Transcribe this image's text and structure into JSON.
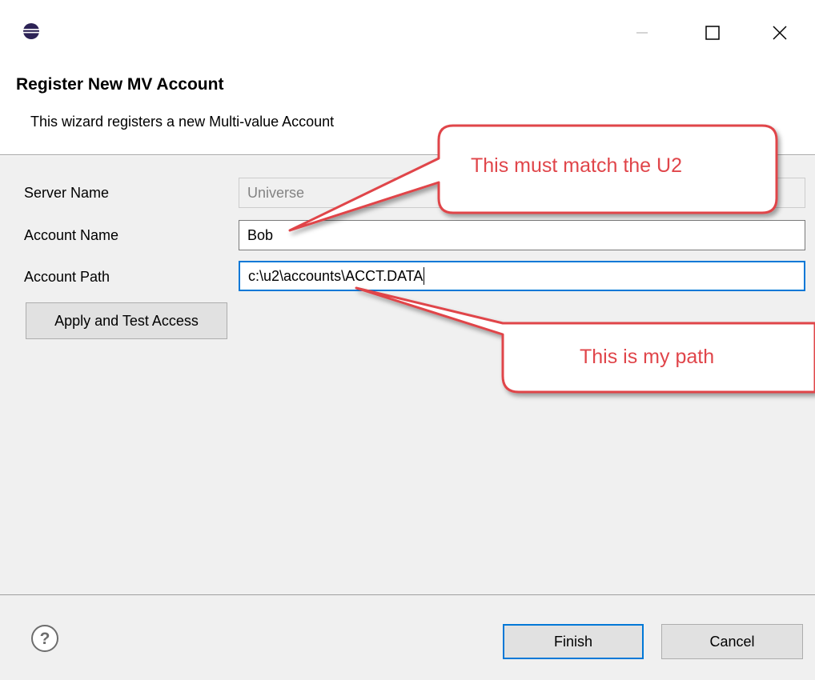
{
  "window": {
    "app_icon": "eclipse-icon",
    "controls": {
      "minimize": "minimize-icon",
      "maximize": "maximize-icon",
      "close": "close-icon"
    }
  },
  "header": {
    "title": "Register New MV Account",
    "description": "This wizard registers a new Multi-value Account"
  },
  "form": {
    "server_name": {
      "label": "Server Name",
      "value": "Universe"
    },
    "account_name": {
      "label": "Account Name",
      "value": "Bob"
    },
    "account_path": {
      "label": "Account Path",
      "value": "c:\\u2\\accounts\\ACCT.DATA"
    },
    "apply_button": "Apply and Test Access"
  },
  "footer": {
    "help_icon": "help-icon",
    "finish": "Finish",
    "cancel": "Cancel"
  },
  "annotations": {
    "callout1": "This must match the U2",
    "callout2": "This is my path"
  },
  "colors": {
    "callout_fill": "#ffffff",
    "callout_stroke": "#e0454a",
    "callout_text": "#e0454a",
    "focus_border": "#0078d7"
  }
}
